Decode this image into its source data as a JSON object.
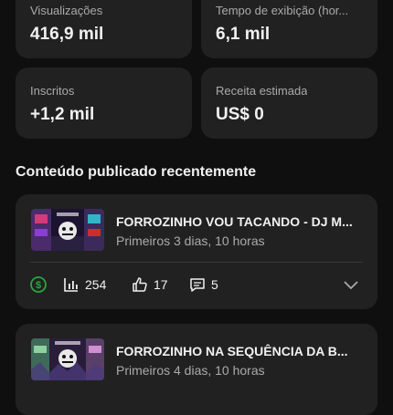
{
  "stats": [
    {
      "label": "Visualizações",
      "value": "416,9 mil"
    },
    {
      "label": "Tempo de exibição (hor...",
      "value": "6,1 mil"
    },
    {
      "label": "Inscritos",
      "value": "+1,2 mil"
    },
    {
      "label": "Receita estimada",
      "value": "US$ 0"
    }
  ],
  "section": {
    "title": "Conteúdo publicado recentemente"
  },
  "videos": [
    {
      "title": "FORROZINHO VOU TACANDO - DJ M...",
      "subtitle": "Primeiros 3 dias, 10 horas",
      "views": "254",
      "likes": "17",
      "comments": "5"
    },
    {
      "title": "FORROZINHO NA SEQUÊNCIA DA B...",
      "subtitle": "Primeiros 4 dias, 10 horas"
    }
  ],
  "colors": {
    "money_icon": "#2ba640",
    "background": "#0f0f0f",
    "card": "#212121"
  }
}
